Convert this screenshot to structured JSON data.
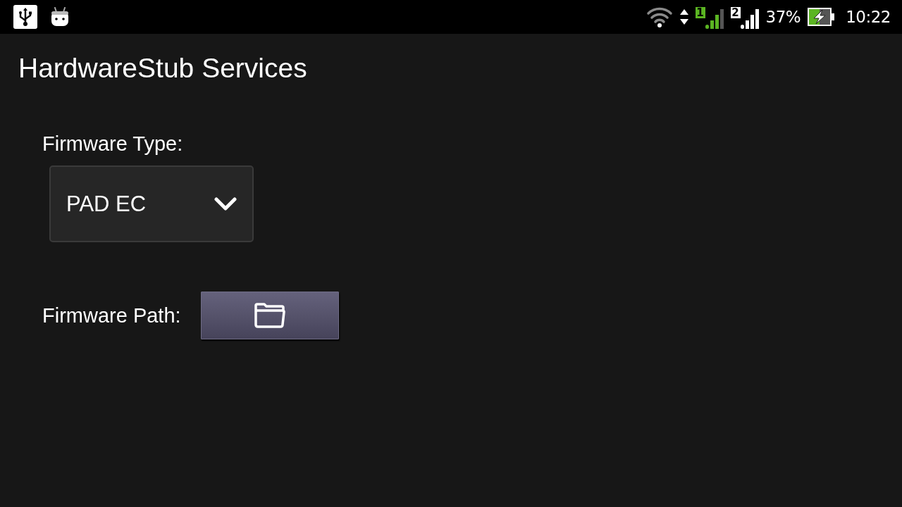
{
  "status_bar": {
    "sims": [
      {
        "label": "1",
        "active": true
      },
      {
        "label": "2",
        "active": false
      }
    ],
    "battery_text": "37%",
    "charging": true,
    "time": "10:22"
  },
  "title": "HardwareStub Services",
  "firmware_type": {
    "label": "Firmware Type:",
    "value": "PAD EC"
  },
  "firmware_path": {
    "label": "Firmware Path:"
  }
}
